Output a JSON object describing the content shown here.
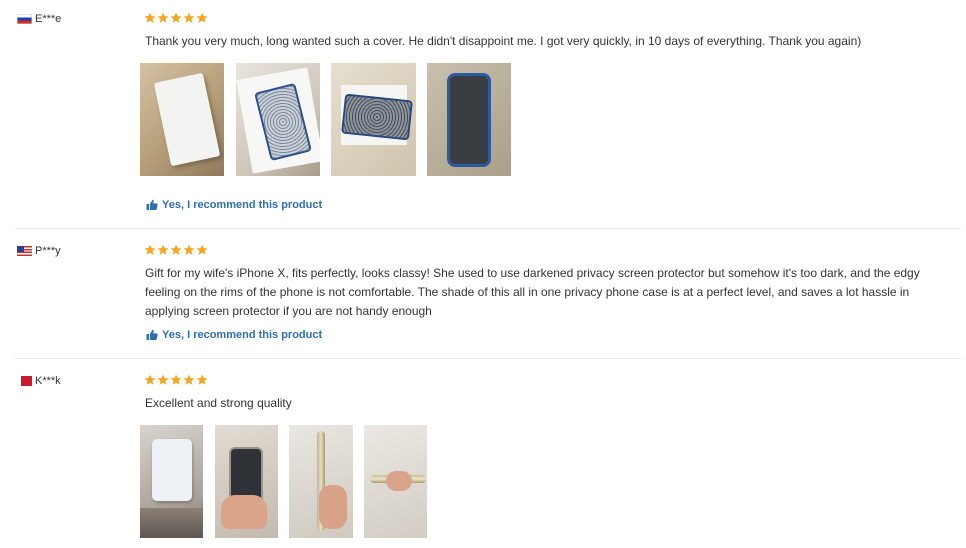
{
  "reviews": [
    {
      "user": "E***e",
      "flag": "russia-flag-icon",
      "rating": 5,
      "text": "Thank you very much, long wanted such a cover. He didn't disappoint me. I got very quickly, in 10 days of everything. Thank you again)",
      "recommend": "Yes, I recommend this product",
      "photo_count": 4
    },
    {
      "user": "P***y",
      "flag": "usa-flag-icon",
      "rating": 5,
      "text": "Gift for my wife's iPhone X, fits perfectly, looks classy! She used to use darkened privacy screen protector but somehow it's too dark, and the edgy feeling on the rims of the phone is not comfortable. The shade of this all in one privacy phone case is at a perfect level, and saves a lot hassle in applying screen protector if you are not handy enough",
      "recommend": "Yes, I recommend this product",
      "photo_count": 0
    },
    {
      "user": "K***k",
      "flag": "bahrain-flag-icon",
      "rating": 5,
      "text": "Excellent and strong quality",
      "photo_count": 4
    }
  ],
  "colors": {
    "star": "#f5a623",
    "recommend_link": "#2f6fb2",
    "divider": "#e8e8e8"
  }
}
